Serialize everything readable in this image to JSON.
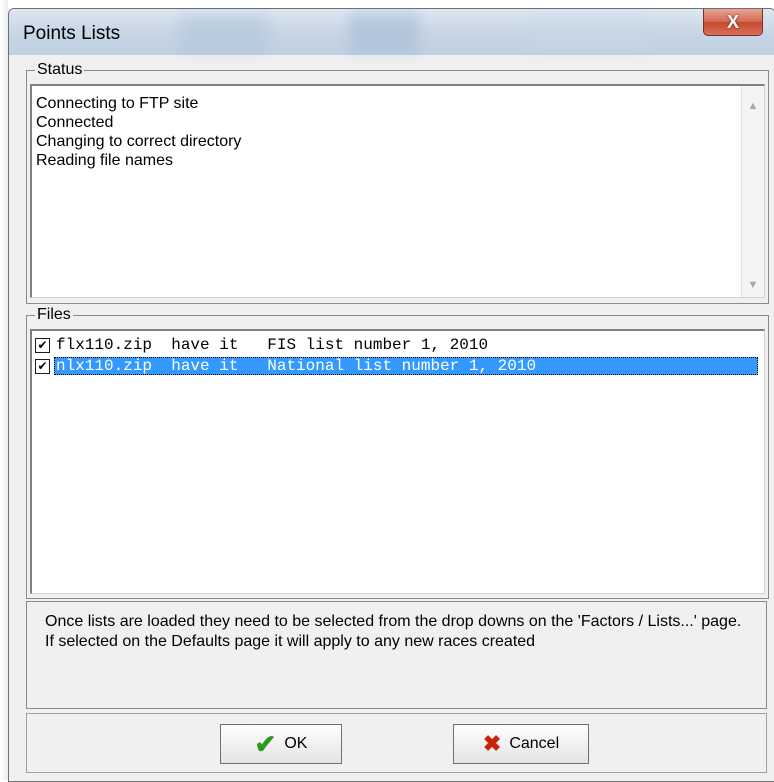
{
  "window": {
    "title": "Points Lists",
    "close_label": "X"
  },
  "status": {
    "group_label": "Status",
    "lines": [
      "Connecting to FTP site",
      "Connected",
      "Changing to correct directory",
      "Reading file names"
    ],
    "scroll_up": "▲",
    "scroll_down": "▼"
  },
  "files": {
    "group_label": "Files",
    "rows": [
      {
        "checked": true,
        "selected": false,
        "text": "flx110.zip  have it   FIS list number 1, 2010"
      },
      {
        "checked": true,
        "selected": true,
        "text": "nlx110.zip  have it   National list number 1, 2010"
      }
    ],
    "check_glyph": "✔"
  },
  "info": {
    "text": "Once lists are loaded they need to be selected from the drop downs on the 'Factors / Lists...' page. If selected on the Defaults page it will apply to any new races created"
  },
  "buttons": {
    "ok_label": "OK",
    "cancel_label": "Cancel",
    "ok_icon": "✔",
    "cancel_icon": "✖"
  },
  "colors": {
    "selection": "#3399ff",
    "ok_icon": "#2a9a1a",
    "cancel_icon": "#c8210e",
    "close_button": "#c44a2e"
  }
}
